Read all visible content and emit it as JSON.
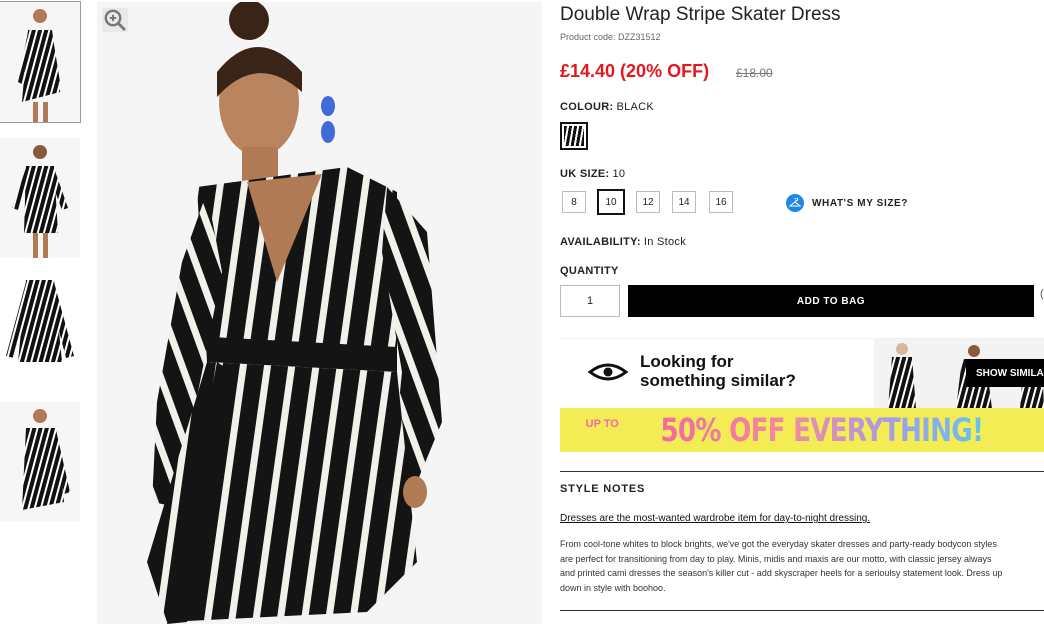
{
  "product": {
    "title": "Double Wrap Stripe Skater Dress",
    "product_code": "Product code: DZZ31512",
    "price_now": "£14.40 (20% OFF)",
    "price_was": "£18.00"
  },
  "colour": {
    "label": "COLOUR:",
    "value": "BLACK"
  },
  "size": {
    "label": "UK SIZE:",
    "value": "10",
    "options": [
      "8",
      "10",
      "12",
      "14",
      "16"
    ],
    "selected": "10",
    "whats_my_size": "WHAT'S MY SIZE?"
  },
  "availability": {
    "label": "AVAILABILITY:",
    "value": "In Stock"
  },
  "quantity": {
    "label": "QUANTITY",
    "value": "1"
  },
  "add_to_bag": "ADD TO BAG",
  "wishlist_fragment": "(",
  "similar": {
    "line1": "Looking for",
    "line2": "something similar?",
    "button": "SHOW SIMILA"
  },
  "promo": {
    "upto": "UP TO",
    "text": "50% OFF EVERYTHING!"
  },
  "style_notes": {
    "title": "STYLE NOTES",
    "link": "Dresses are the most-wanted wardrobe item for day-to-night dressing.",
    "body": "From cool-tone whites to block brights, we've got the everyday skater dresses and party-ready bodycon styles\nare perfect for transitioning from day to play. Minis, midis and maxis are our motto, with classic jersey always\nand printed cami dresses the season's killer cut - add skyscraper heels for a serioulsy statement look. Dress up\ndown in style with boohoo."
  },
  "colors": {
    "price": "#e3171d",
    "accent_blue": "#1e88e5",
    "promo_bg": "#f3ec55"
  },
  "icons": [
    "zoom-icon",
    "hanger-icon",
    "eye-icon"
  ]
}
